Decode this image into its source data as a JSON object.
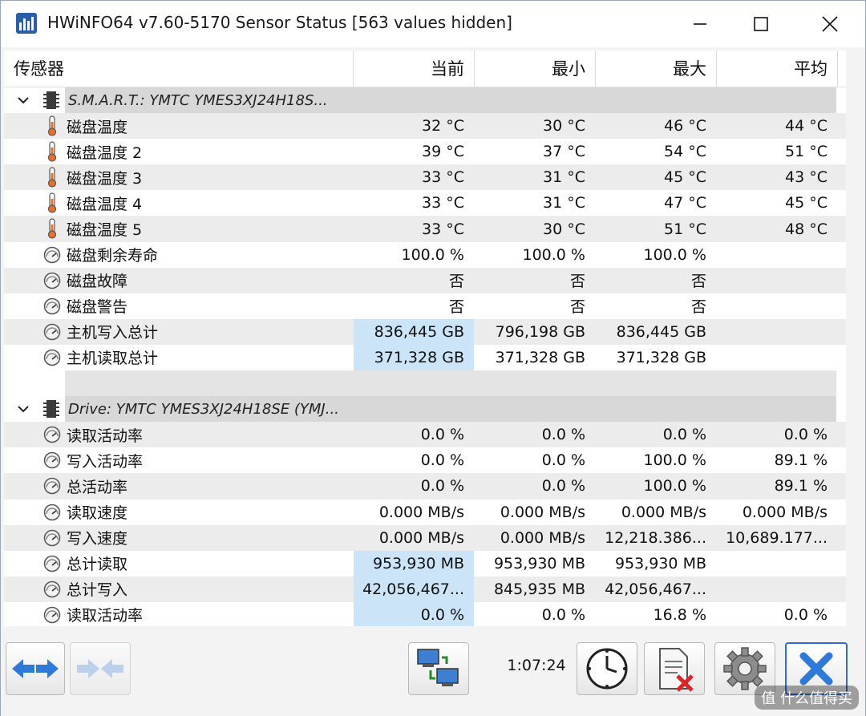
{
  "window": {
    "title": "HWiNFO64 v7.60-5170 Sensor Status [563 values hidden]"
  },
  "columns": [
    "传感器",
    "当前",
    "最小",
    "最大",
    "平均"
  ],
  "groups": [
    {
      "title": "S.M.A.R.T.: YMTC YMES3XJ24H18S...",
      "rows": [
        {
          "icon": "thermometer-icon",
          "name": "磁盘温度",
          "cur": "32 °C",
          "min": "30 °C",
          "max": "46 °C",
          "avg": "44 °C",
          "hl": false
        },
        {
          "icon": "thermometer-icon",
          "name": "磁盘温度 2",
          "cur": "39 °C",
          "min": "37 °C",
          "max": "54 °C",
          "avg": "51 °C",
          "hl": false
        },
        {
          "icon": "thermometer-icon",
          "name": "磁盘温度 3",
          "cur": "33 °C",
          "min": "31 °C",
          "max": "45 °C",
          "avg": "43 °C",
          "hl": false
        },
        {
          "icon": "thermometer-icon",
          "name": "磁盘温度 4",
          "cur": "33 °C",
          "min": "31 °C",
          "max": "47 °C",
          "avg": "45 °C",
          "hl": false
        },
        {
          "icon": "thermometer-icon",
          "name": "磁盘温度 5",
          "cur": "33 °C",
          "min": "30 °C",
          "max": "51 °C",
          "avg": "48 °C",
          "hl": false
        },
        {
          "icon": "gauge-icon",
          "name": "磁盘剩余寿命",
          "cur": "100.0 %",
          "min": "100.0 %",
          "max": "100.0 %",
          "avg": "",
          "hl": false
        },
        {
          "icon": "gauge-icon",
          "name": "磁盘故障",
          "cur": "否",
          "min": "否",
          "max": "否",
          "avg": "",
          "hl": false
        },
        {
          "icon": "gauge-icon",
          "name": "磁盘警告",
          "cur": "否",
          "min": "否",
          "max": "否",
          "avg": "",
          "hl": false
        },
        {
          "icon": "gauge-icon",
          "name": "主机写入总计",
          "cur": "836,445 GB",
          "min": "796,198 GB",
          "max": "836,445 GB",
          "avg": "",
          "hl": true
        },
        {
          "icon": "gauge-icon",
          "name": "主机读取总计",
          "cur": "371,328 GB",
          "min": "371,328 GB",
          "max": "371,328 GB",
          "avg": "",
          "hl": true
        }
      ]
    },
    {
      "title": "Drive: YMTC YMES3XJ24H18SE (YMJ...",
      "rows": [
        {
          "icon": "gauge-icon",
          "name": "读取活动率",
          "cur": "0.0 %",
          "min": "0.0 %",
          "max": "0.0 %",
          "avg": "0.0 %",
          "hl": false
        },
        {
          "icon": "gauge-icon",
          "name": "写入活动率",
          "cur": "0.0 %",
          "min": "0.0 %",
          "max": "100.0 %",
          "avg": "89.1 %",
          "hl": false
        },
        {
          "icon": "gauge-icon",
          "name": "总活动率",
          "cur": "0.0 %",
          "min": "0.0 %",
          "max": "100.0 %",
          "avg": "89.1 %",
          "hl": false
        },
        {
          "icon": "gauge-icon",
          "name": "读取速度",
          "cur": "0.000 MB/s",
          "min": "0.000 MB/s",
          "max": "0.000 MB/s",
          "avg": "0.000 MB/s",
          "hl": false
        },
        {
          "icon": "gauge-icon",
          "name": "写入速度",
          "cur": "0.000 MB/s",
          "min": "0.000 MB/s",
          "max": "12,218.386...",
          "avg": "10,689.177...",
          "hl": false
        },
        {
          "icon": "gauge-icon",
          "name": "总计读取",
          "cur": "953,930 MB",
          "min": "953,930 MB",
          "max": "953,930 MB",
          "avg": "",
          "hl": true
        },
        {
          "icon": "gauge-icon",
          "name": "总计写入",
          "cur": "42,056,467...",
          "min": "845,935 MB",
          "max": "42,056,467...",
          "avg": "",
          "hl": true
        },
        {
          "icon": "gauge-icon",
          "name": "读取活动率",
          "cur": "0.0 %",
          "min": "0.0 %",
          "max": "16.8 %",
          "avg": "0.0 %",
          "hl": true
        }
      ]
    }
  ],
  "toolbar": {
    "timer": "1:07:24",
    "buttons": [
      "nav-arrows-icon",
      "collapse-arrows-icon",
      "network-icon",
      "clock-icon",
      "report-delete-icon",
      "settings-gear-icon",
      "close-x-icon"
    ]
  },
  "watermark": "值 什么值得买",
  "colors": {
    "highlight": "#cce4f7",
    "group_band": "#d8d8d8",
    "accent": "#2b6fd6"
  }
}
